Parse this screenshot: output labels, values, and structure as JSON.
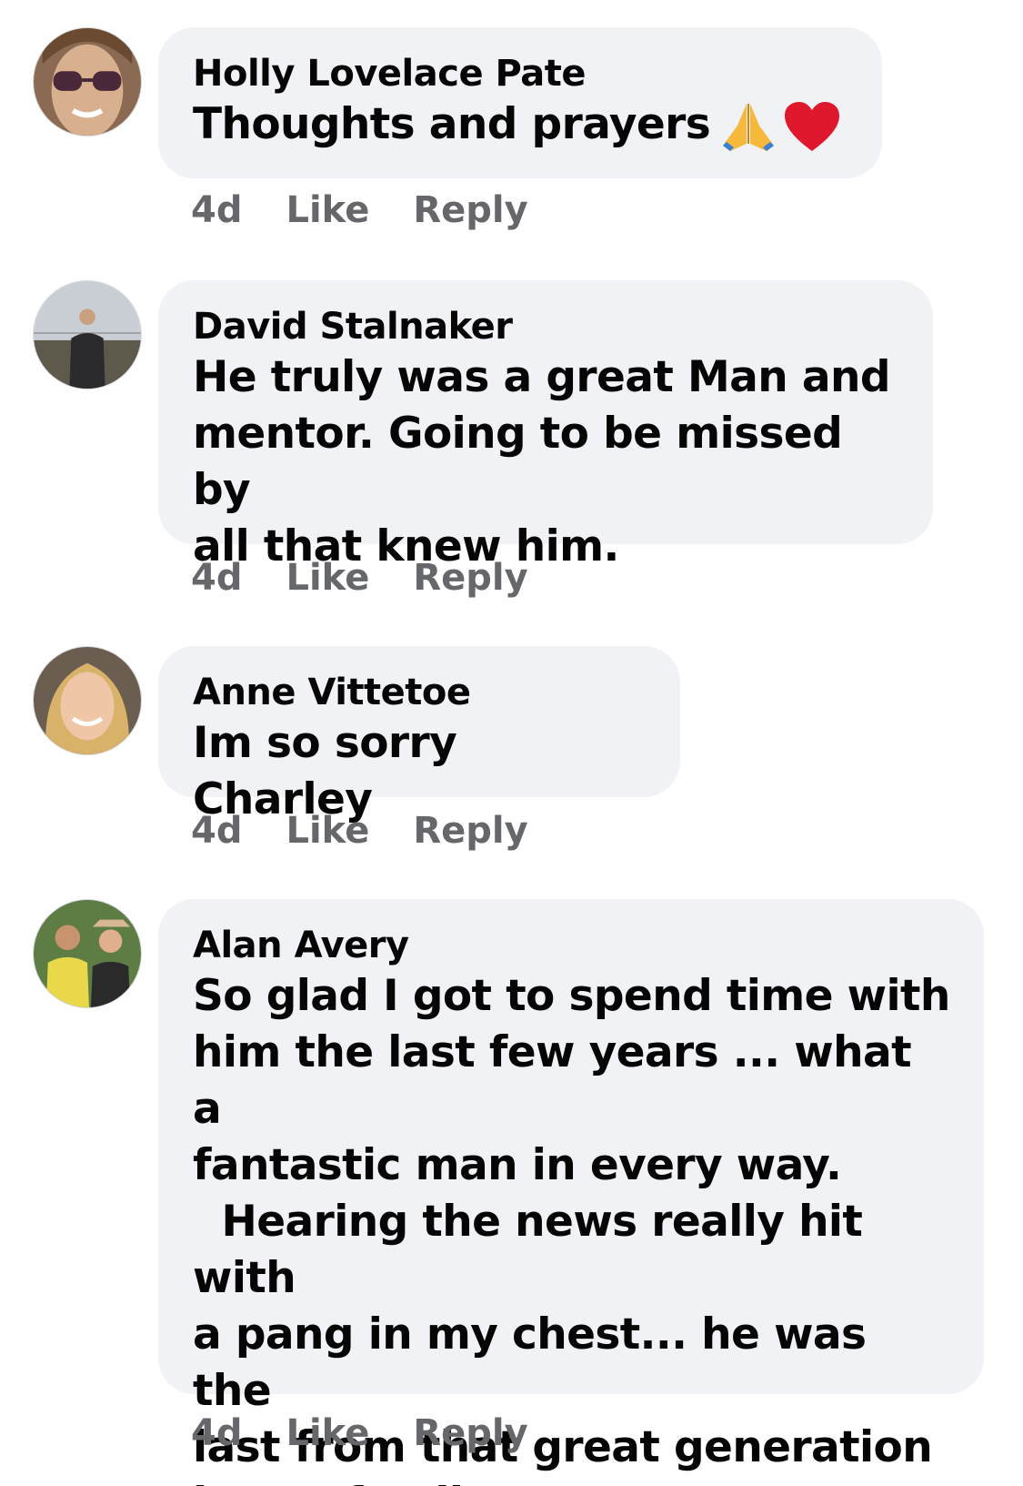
{
  "comments": [
    {
      "author": "Holly Lovelace Pate",
      "text": "Thoughts and prayers",
      "emojis": [
        "folded-hands-icon",
        "red-heart-icon"
      ],
      "time": "4d",
      "like_label": "Like",
      "reply_label": "Reply"
    },
    {
      "author": "David Stalnaker",
      "text": "He truly was a great Man and\nmentor. Going to be missed by\nall that knew him.",
      "time": "4d",
      "like_label": "Like",
      "reply_label": "Reply"
    },
    {
      "author": "Anne Vittetoe",
      "text": "Im so sorry Charley",
      "time": "4d",
      "like_label": "Like",
      "reply_label": "Reply"
    },
    {
      "author": "Alan Avery",
      "text": "So glad I got to spend time with\nhim the last few years ... what a\nfantastic man in every way.\n  Hearing the news really hit with\na pang in my chest... he was the\nlast from that great generation\nin our family.",
      "time": "4d",
      "like_label": "Like",
      "reply_label": "Reply"
    }
  ],
  "colors": {
    "bubble": "#f0f2f5",
    "meta_text": "#65676b",
    "primary_text": "#050505",
    "heart": "#e0182d",
    "hands": "#f6b93b"
  }
}
